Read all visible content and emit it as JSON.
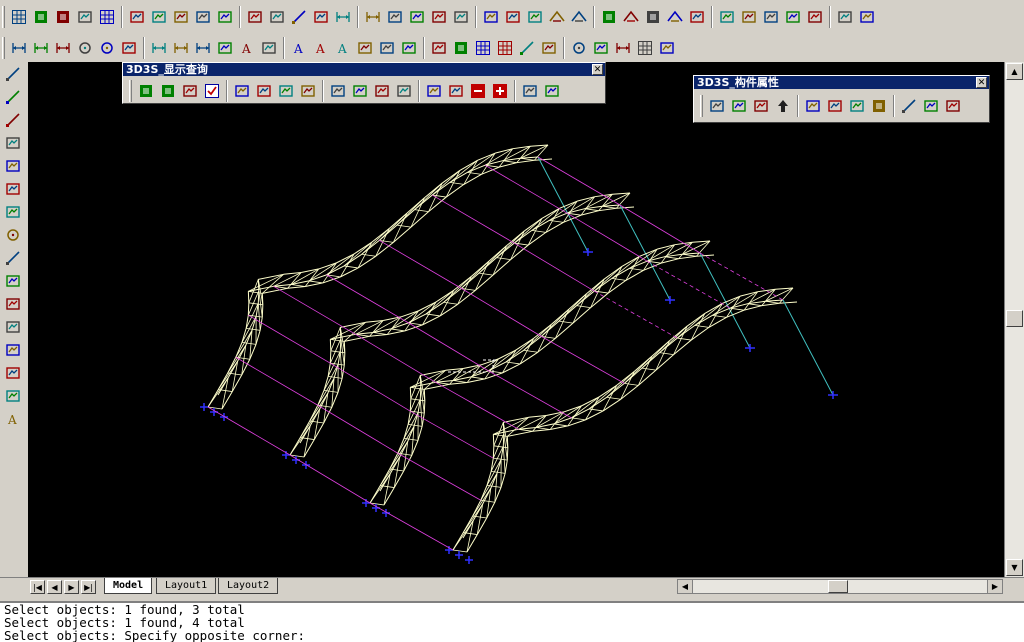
{
  "toolbar_row1": {
    "icons": [
      "grid-icon",
      "layer-icon",
      "layer-icon",
      "color-icon",
      "table-icon",
      "snap-icon",
      "snap-icon",
      "snap-icon",
      "pan-icon",
      "snap-icon",
      "snap-icon",
      "snap-icon",
      "linetype-icon",
      "arrow-icon",
      "dimension-icon",
      "dimension-icon",
      "print-icon",
      "print-icon",
      "print-icon",
      "print-icon",
      "print-icon",
      "list-icon",
      "calculator-icon",
      "roof-icon",
      "roof-icon",
      "layer-icon",
      "roof-icon",
      "layer-icon",
      "arch-icon",
      "tool-icon",
      "tool-icon",
      "tool-icon",
      "tool-icon",
      "book-icon",
      "window-icon",
      "help-icon",
      "exit-icon"
    ]
  },
  "toolbar_row2": {
    "icons": [
      "dimension-icon",
      "dimension-icon",
      "dimension-icon",
      "circle-icon",
      "circle-icon",
      "angle-icon",
      "dimension-icon",
      "dimension-icon",
      "dimension-icon",
      "leader-icon",
      "text-icon",
      "center-icon",
      "text-icon",
      "text-icon",
      "text-icon",
      "edit-icon",
      "cube-icon",
      "cube-icon",
      "square-icon",
      "green-box-icon",
      "grid-icon",
      "grid-icon",
      "line-icon",
      "curve-icon",
      "circle-icon",
      "cross-icon",
      "dimension-icon",
      "table-icon",
      "color-bar-icon"
    ]
  },
  "left_toolbar": {
    "icons": [
      "line-icon",
      "construction-line-icon",
      "polyline-icon",
      "undo-arc-icon",
      "polygon-icon",
      "rectangle-icon",
      "arc-icon",
      "circle-icon",
      "spline-icon",
      "ellipse-icon",
      "insert-block-icon",
      "make-block-icon",
      "point-icon",
      "hatch-icon",
      "region-icon",
      "text-icon"
    ]
  },
  "float_display": {
    "title": "3D3S_显示查询",
    "icons": [
      "green-icon",
      "green-icon",
      "orange-icon",
      "checkbox-icon",
      "filter-icon",
      "blue-icon",
      "blue-icon",
      "pink-icon",
      "pink-icon",
      "red-icon",
      "blue-icon",
      "blue-icon",
      "blue-icon",
      "blue-icon",
      "minus-icon",
      "plus-icon",
      "blue-icon",
      "list-icon"
    ]
  },
  "float_props": {
    "title": "3D3S_构件属性",
    "icons": [
      "beam-icon",
      "beam-icon",
      "label-icon",
      "arrow-up-icon",
      "copy-icon",
      "pen-icon",
      "section-icon",
      "layers-icon",
      "line-icon",
      "support-icon",
      "link-icon"
    ]
  },
  "tabs": [
    {
      "label": "Model",
      "active": true
    },
    {
      "label": "Layout1",
      "active": false
    },
    {
      "label": "Layout2",
      "active": false
    }
  ],
  "command": {
    "lines": [
      "Select objects: 1 found, 3 total",
      "Select objects: 1 found, 4 total",
      "Select objects: Specify opposite corner:"
    ]
  },
  "colors": {
    "truss": "#ffffcc",
    "purlin": "#e040e0",
    "cable": "#40c0c0",
    "support": "#3030ff"
  }
}
